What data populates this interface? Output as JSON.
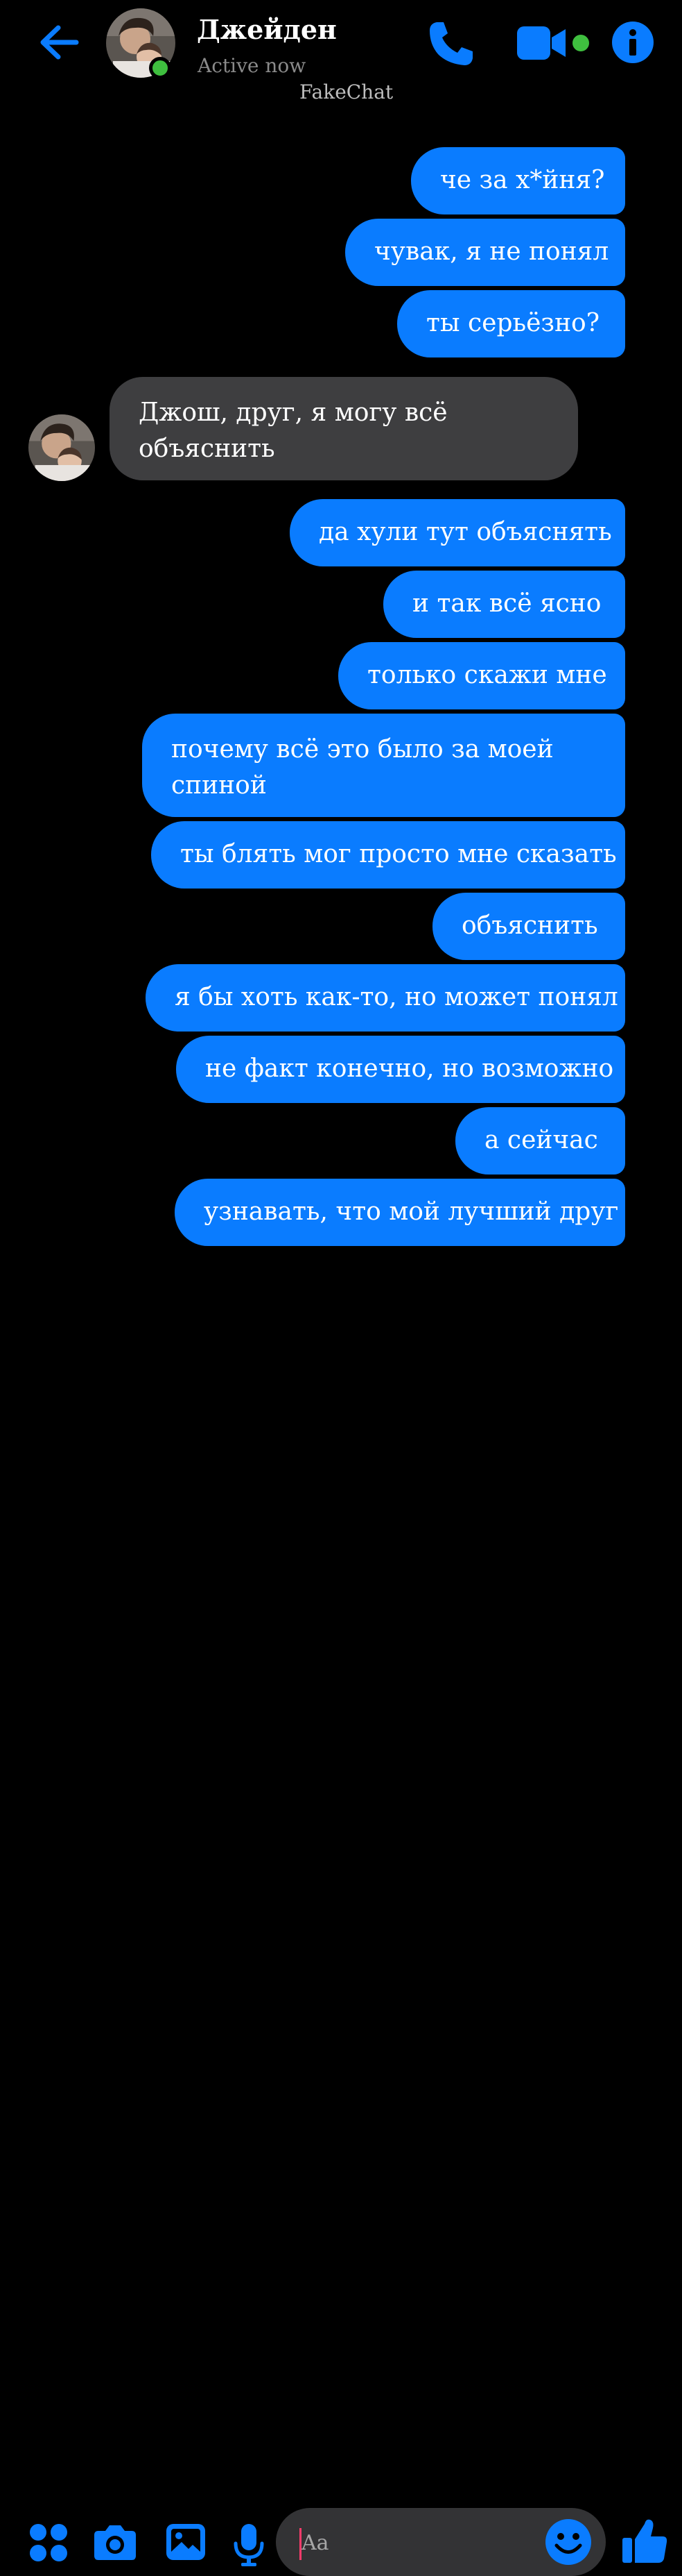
{
  "header": {
    "name": "Джейден",
    "status": "Active now",
    "watermark": "FakeChat"
  },
  "messages": [
    {
      "side": "sent",
      "text": "че за х*йня?"
    },
    {
      "side": "sent",
      "text": "чувак, я не понял"
    },
    {
      "side": "sent",
      "text": "ты серьёзно?"
    },
    {
      "side": "received",
      "text": "Джош, друг, я могу всё объяснить"
    },
    {
      "side": "sent",
      "text": "да хули тут объяснять"
    },
    {
      "side": "sent",
      "text": "и так всё ясно"
    },
    {
      "side": "sent",
      "text": "только скажи мне"
    },
    {
      "side": "sent",
      "text": "почему всё это было за моей спиной"
    },
    {
      "side": "sent",
      "text": "ты блять мог просто мне сказать"
    },
    {
      "side": "sent",
      "text": "объяснить"
    },
    {
      "side": "sent",
      "text": "я бы хоть как-то, но может понял"
    },
    {
      "side": "sent",
      "text": "не факт конечно, но возможно"
    },
    {
      "side": "sent",
      "text": "а сейчас"
    },
    {
      "side": "sent",
      "text": "узнавать, что мой лучший друг"
    }
  ],
  "composer": {
    "placeholder": "Aa"
  },
  "colors": {
    "accent": "#0a7cff",
    "received_bubble": "#3e3e40",
    "online": "#3fbf3f",
    "background": "#000000"
  },
  "icons": [
    "back-arrow-icon",
    "phone-icon",
    "video-camera-icon",
    "info-icon",
    "apps-grid-icon",
    "camera-icon",
    "image-icon",
    "microphone-icon",
    "smiley-icon",
    "thumbs-up-icon"
  ]
}
